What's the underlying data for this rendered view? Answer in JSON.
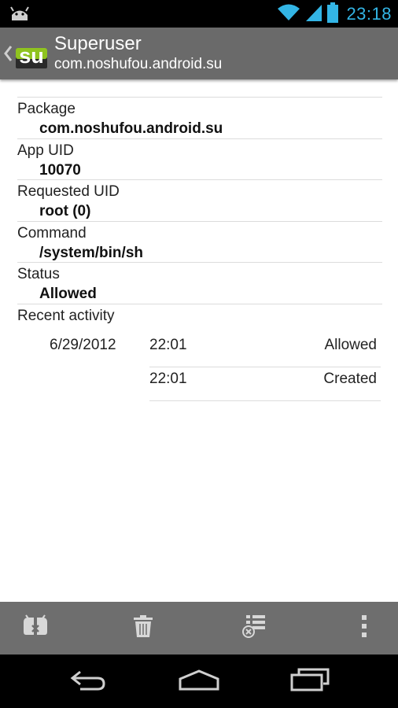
{
  "status_bar": {
    "time": "23:18",
    "icons": [
      "android-notification-icon",
      "wifi-icon",
      "signal-icon",
      "battery-icon"
    ]
  },
  "action_bar": {
    "title": "Superuser",
    "subtitle": "com.noshufou.android.su",
    "icon": "su-app-icon",
    "icon_text": "su"
  },
  "details": {
    "package": {
      "label": "Package",
      "value": "com.noshufou.android.su"
    },
    "app_uid": {
      "label": "App UID",
      "value": "10070"
    },
    "requested_uid": {
      "label": "Requested UID",
      "value": "root (0)"
    },
    "command": {
      "label": "Command",
      "value": "/system/bin/sh"
    },
    "status": {
      "label": "Status",
      "value": "Allowed"
    }
  },
  "recent_activity": {
    "title": "Recent activity",
    "date": "6/29/2012",
    "entries": [
      {
        "time": "22:01",
        "status": "Allowed"
      },
      {
        "time": "22:01",
        "status": "Created"
      }
    ]
  },
  "bottom_actions": [
    "toggle-icon",
    "delete-icon",
    "clear-log-icon",
    "overflow-menu-icon"
  ],
  "navigation": [
    "back-icon",
    "home-icon",
    "recent-apps-icon"
  ],
  "colors": {
    "status_clock": "#33b5e5",
    "action_bar": "#6a6a6a",
    "su_green": "#8fc31f"
  }
}
